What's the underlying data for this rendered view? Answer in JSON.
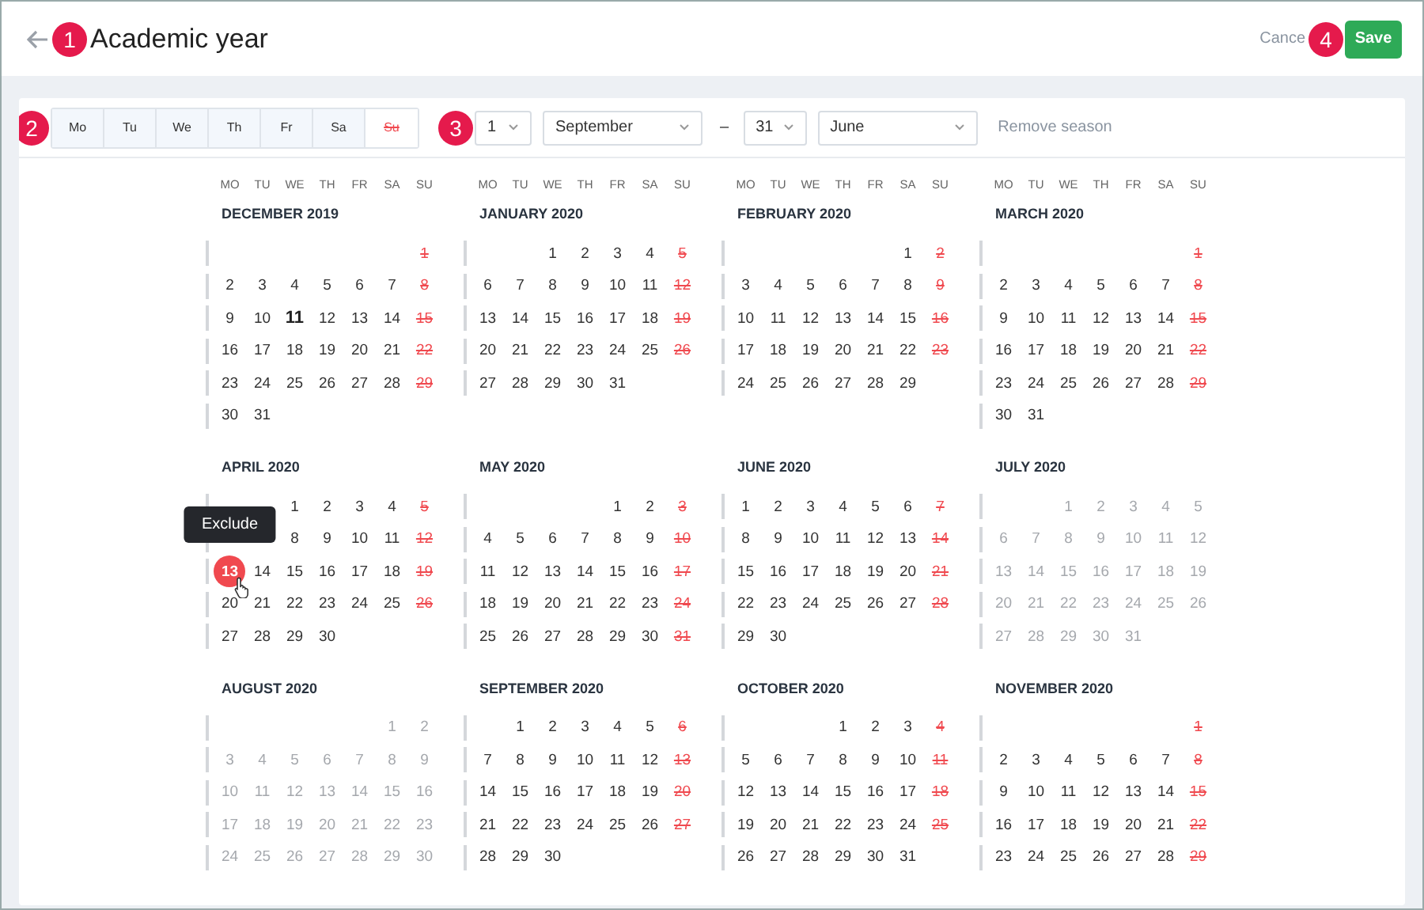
{
  "header": {
    "title": "Academic year",
    "cancel": "Cance",
    "save": "Save"
  },
  "toolbar": {
    "weekdays": [
      {
        "label": "Mo",
        "selected": true
      },
      {
        "label": "Tu",
        "selected": true
      },
      {
        "label": "We",
        "selected": true
      },
      {
        "label": "Th",
        "selected": true
      },
      {
        "label": "Fr",
        "selected": true
      },
      {
        "label": "Sa",
        "selected": true
      },
      {
        "label": "Su",
        "selected": false
      }
    ],
    "start_day": "1",
    "start_month": "September",
    "separator": "–",
    "end_day": "31",
    "end_month": "June",
    "remove": "Remove season"
  },
  "calendar": {
    "weekday_headers": [
      [
        "MO",
        "TU",
        "WE",
        "TH",
        "FR",
        "SA",
        "SU"
      ],
      [
        "MO",
        "TU",
        "WE",
        "TH",
        "FR",
        "SA",
        "SU"
      ],
      [
        "MO",
        "TU",
        "WE",
        "TH",
        "FR",
        "SA",
        "SU"
      ],
      [
        "MO",
        "TU",
        "WE",
        "TH",
        "FR",
        "SA",
        "SU"
      ]
    ],
    "tooltip": "Exclude",
    "months": [
      {
        "title": "DECEMBER 2019",
        "in_season": true,
        "weeks": [
          {
            "right_aligned": true,
            "days": [
              "1"
            ]
          },
          {
            "days": [
              "2",
              "3",
              "4",
              "5",
              "6",
              "7",
              "8"
            ]
          },
          {
            "days": [
              "9",
              "10",
              {
                "label": "11",
                "kind": "today"
              },
              "12",
              "13",
              "14",
              "15"
            ]
          },
          {
            "days": [
              "16",
              "17",
              "18",
              "19",
              "20",
              "21",
              "22"
            ]
          },
          {
            "days": [
              "23",
              "24",
              "25",
              "26",
              "27",
              "28",
              "29"
            ]
          },
          {
            "days": [
              "30",
              "31"
            ]
          }
        ]
      },
      {
        "title": "JANUARY 2020",
        "in_season": true,
        "weeks": [
          {
            "right_aligned": true,
            "days": [
              "1",
              "2",
              "3",
              "4",
              "5"
            ]
          },
          {
            "days": [
              "6",
              "7",
              "8",
              "9",
              "10",
              "11",
              "12"
            ]
          },
          {
            "days": [
              "13",
              "14",
              "15",
              "16",
              "17",
              "18",
              "19"
            ]
          },
          {
            "days": [
              "20",
              "21",
              "22",
              "23",
              "24",
              "25",
              "26"
            ]
          },
          {
            "days": [
              "27",
              "28",
              "29",
              "30",
              "31"
            ]
          }
        ]
      },
      {
        "title": "FEBRUARY 2020",
        "in_season": true,
        "weeks": [
          {
            "right_aligned": true,
            "days": [
              "1",
              "2"
            ]
          },
          {
            "days": [
              "3",
              "4",
              "5",
              "6",
              "7",
              "8",
              "9"
            ]
          },
          {
            "days": [
              "10",
              "11",
              "12",
              "13",
              "14",
              "15",
              "16"
            ]
          },
          {
            "days": [
              "17",
              "18",
              "19",
              "20",
              "21",
              "22",
              "23"
            ]
          },
          {
            "days": [
              "24",
              "25",
              "26",
              "27",
              "28",
              "29"
            ]
          }
        ]
      },
      {
        "title": "MARCH 2020",
        "in_season": true,
        "weeks": [
          {
            "right_aligned": true,
            "days": [
              "1"
            ]
          },
          {
            "days": [
              "2",
              "3",
              "4",
              "5",
              "6",
              "7",
              "8"
            ]
          },
          {
            "days": [
              "9",
              "10",
              "11",
              "12",
              "13",
              "14",
              "15"
            ]
          },
          {
            "days": [
              "16",
              "17",
              "18",
              "19",
              "20",
              "21",
              "22"
            ]
          },
          {
            "days": [
              "23",
              "24",
              "25",
              "26",
              "27",
              "28",
              "29"
            ]
          },
          {
            "days": [
              "30",
              "31"
            ]
          }
        ]
      },
      {
        "title": "APRIL 2020",
        "in_season": true,
        "weeks": [
          {
            "right_aligned": true,
            "days": [
              "1",
              "2",
              "3",
              "4",
              "5"
            ]
          },
          {
            "right_aligned": true,
            "days": [
              "8",
              "9",
              "10",
              "11",
              "12"
            ]
          },
          {
            "days": [
              {
                "label": "13",
                "kind": "hovered"
              },
              "14",
              "15",
              "16",
              "17",
              "18",
              "19"
            ]
          },
          {
            "days": [
              "20",
              "21",
              "22",
              "23",
              "24",
              "25",
              "26"
            ]
          },
          {
            "days": [
              "27",
              "28",
              "29",
              "30"
            ]
          }
        ]
      },
      {
        "title": "MAY 2020",
        "in_season": true,
        "weeks": [
          {
            "right_aligned": true,
            "days": [
              "1",
              "2",
              "3"
            ]
          },
          {
            "days": [
              "4",
              "5",
              "6",
              "7",
              "8",
              "9",
              "10"
            ]
          },
          {
            "days": [
              "11",
              "12",
              "13",
              "14",
              "15",
              "16",
              "17"
            ]
          },
          {
            "days": [
              "18",
              "19",
              "20",
              "21",
              "22",
              "23",
              "24"
            ]
          },
          {
            "days": [
              "25",
              "26",
              "27",
              "28",
              "29",
              "30",
              "31"
            ]
          }
        ]
      },
      {
        "title": "JUNE 2020",
        "in_season": true,
        "weeks": [
          {
            "days": [
              "1",
              "2",
              "3",
              "4",
              "5",
              "6",
              "7"
            ]
          },
          {
            "days": [
              "8",
              "9",
              "10",
              "11",
              "12",
              "13",
              "14"
            ]
          },
          {
            "days": [
              "15",
              "16",
              "17",
              "18",
              "19",
              "20",
              "21"
            ]
          },
          {
            "days": [
              "22",
              "23",
              "24",
              "25",
              "26",
              "27",
              "28"
            ]
          },
          {
            "days": [
              "29",
              "30"
            ]
          }
        ]
      },
      {
        "title": "JULY 2020",
        "in_season": false,
        "weeks": [
          {
            "right_aligned": true,
            "days": [
              "1",
              "2",
              "3",
              "4",
              "5"
            ]
          },
          {
            "days": [
              "6",
              "7",
              "8",
              "9",
              "10",
              "11",
              "12"
            ]
          },
          {
            "days": [
              "13",
              "14",
              "15",
              "16",
              "17",
              "18",
              "19"
            ]
          },
          {
            "days": [
              "20",
              "21",
              "22",
              "23",
              "24",
              "25",
              "26"
            ]
          },
          {
            "days": [
              "27",
              "28",
              "29",
              "30",
              "31"
            ]
          }
        ]
      },
      {
        "title": "AUGUST 2020",
        "in_season": false,
        "weeks": [
          {
            "right_aligned": true,
            "days": [
              "1",
              "2"
            ]
          },
          {
            "days": [
              "3",
              "4",
              "5",
              "6",
              "7",
              "8",
              "9"
            ]
          },
          {
            "days": [
              "10",
              "11",
              "12",
              "13",
              "14",
              "15",
              "16"
            ]
          },
          {
            "days": [
              "17",
              "18",
              "19",
              "20",
              "21",
              "22",
              "23"
            ]
          },
          {
            "days": [
              "24",
              "25",
              "26",
              "27",
              "28",
              "29",
              "30"
            ]
          }
        ]
      },
      {
        "title": "SEPTEMBER 2020",
        "in_season": true,
        "weeks": [
          {
            "right_aligned": true,
            "days": [
              "1",
              "2",
              "3",
              "4",
              "5",
              "6"
            ]
          },
          {
            "days": [
              "7",
              "8",
              "9",
              "10",
              "11",
              "12",
              "13"
            ]
          },
          {
            "days": [
              "14",
              "15",
              "16",
              "17",
              "18",
              "19",
              "20"
            ]
          },
          {
            "days": [
              "21",
              "22",
              "23",
              "24",
              "25",
              "26",
              "27"
            ]
          },
          {
            "days": [
              "28",
              "29",
              "30"
            ]
          }
        ]
      },
      {
        "title": "OCTOBER 2020",
        "in_season": true,
        "weeks": [
          {
            "right_aligned": true,
            "days": [
              "1",
              "2",
              "3",
              "4"
            ]
          },
          {
            "days": [
              "5",
              "6",
              "7",
              "8",
              "9",
              "10",
              "11"
            ]
          },
          {
            "days": [
              "12",
              "13",
              "14",
              "15",
              "16",
              "17",
              "18"
            ]
          },
          {
            "days": [
              "19",
              "20",
              "21",
              "22",
              "23",
              "24",
              "25"
            ]
          },
          {
            "days": [
              "26",
              "27",
              "28",
              "29",
              "30",
              "31"
            ]
          }
        ]
      },
      {
        "title": "NOVEMBER 2020",
        "in_season": true,
        "weeks": [
          {
            "right_aligned": true,
            "days": [
              "1"
            ]
          },
          {
            "days": [
              "2",
              "3",
              "4",
              "5",
              "6",
              "7",
              "8"
            ]
          },
          {
            "days": [
              "9",
              "10",
              "11",
              "12",
              "13",
              "14",
              "15"
            ]
          },
          {
            "days": [
              "16",
              "17",
              "18",
              "19",
              "20",
              "21",
              "22"
            ]
          },
          {
            "days": [
              "23",
              "24",
              "25",
              "26",
              "27",
              "28",
              "29"
            ]
          }
        ]
      }
    ]
  },
  "callouts": [
    {
      "label": "1"
    },
    {
      "label": "2"
    },
    {
      "label": "3"
    },
    {
      "label": "4"
    }
  ]
}
